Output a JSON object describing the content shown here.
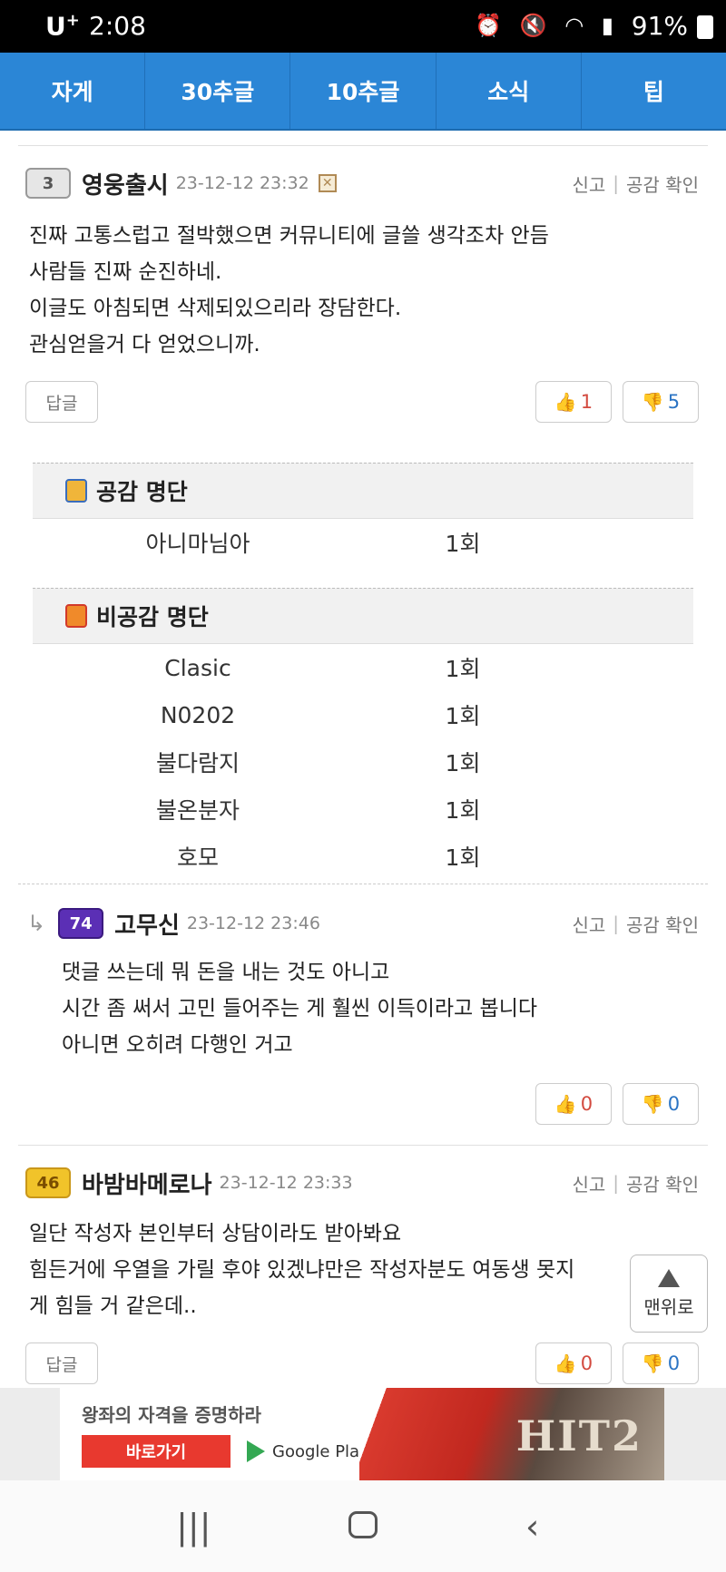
{
  "status": {
    "carrier": "U",
    "carrier_sup": "+",
    "time": "2:08",
    "battery": "91%"
  },
  "nav": {
    "tabs": [
      "자게",
      "30추글",
      "10추글",
      "소식",
      "팁"
    ]
  },
  "comments": [
    {
      "level": "3",
      "author": "영웅출시",
      "date": "23-12-12 23:32",
      "report": "신고",
      "empathy_check": "공감 확인",
      "lines": [
        "진짜 고통스럽고 절박했으면 커뮤니티에 글쓸 생각조차 안듬",
        "사람들 진짜 순진하네.",
        "이글도 아침되면 삭제되있으리라 장담한다.",
        "관심얻을거 다 얻었으니까."
      ],
      "reply_label": "답글",
      "up": "1",
      "down": "5"
    },
    {
      "level": "74",
      "author": "고무신",
      "date": "23-12-12 23:46",
      "report": "신고",
      "empathy_check": "공감 확인",
      "lines": [
        "댓글 쓰는데 뭐 돈을 내는 것도 아니고",
        "시간 좀 써서 고민 들어주는 게 훨씬 이득이라고 봅니다",
        "아니면 오히려 다행인 거고"
      ],
      "up": "0",
      "down": "0"
    },
    {
      "level": "46",
      "author": "바밤바메로나",
      "date": "23-12-12 23:33",
      "report": "신고",
      "empathy_check": "공감 확인",
      "lines": [
        "일단 작성자 본인부터 상담이라도 받아봐요",
        "힘든거에 우열을 가릴 후야 있겠냐만은 작성자분도 여동생 못지",
        "게 힘들 거 같은데.."
      ],
      "reply_label": "답글",
      "up": "0",
      "down": "0"
    }
  ],
  "empathy_list": {
    "title": "공감 명단",
    "rows": [
      {
        "name": "아니마님아",
        "count": "1회"
      }
    ]
  },
  "nonempathy_list": {
    "title": "비공감 명단",
    "rows": [
      {
        "name": "Clasic",
        "count": "1회"
      },
      {
        "name": "N0202",
        "count": "1회"
      },
      {
        "name": "불다람지",
        "count": "1회"
      },
      {
        "name": "불온분자",
        "count": "1회"
      },
      {
        "name": "호모",
        "count": "1회"
      }
    ]
  },
  "totop_label": "맨위로",
  "ad": {
    "tagline": "왕좌의 자격을 증명하라",
    "cta": "바로가기",
    "store": "Google Play",
    "logo": "HIT2"
  },
  "icons": {
    "thumbs_up": "thumbs-up-icon",
    "thumbs_down": "thumbs-down-icon",
    "reply_arrow": "reply-arrow-icon",
    "nav_recent": "recent-apps-icon",
    "nav_home": "home-icon",
    "nav_back": "back-icon"
  },
  "colors": {
    "nav_blue": "#2b86d6",
    "upvote_red": "#d34a3f",
    "downvote_blue": "#2b74c4",
    "ad_red": "#e8392f"
  }
}
